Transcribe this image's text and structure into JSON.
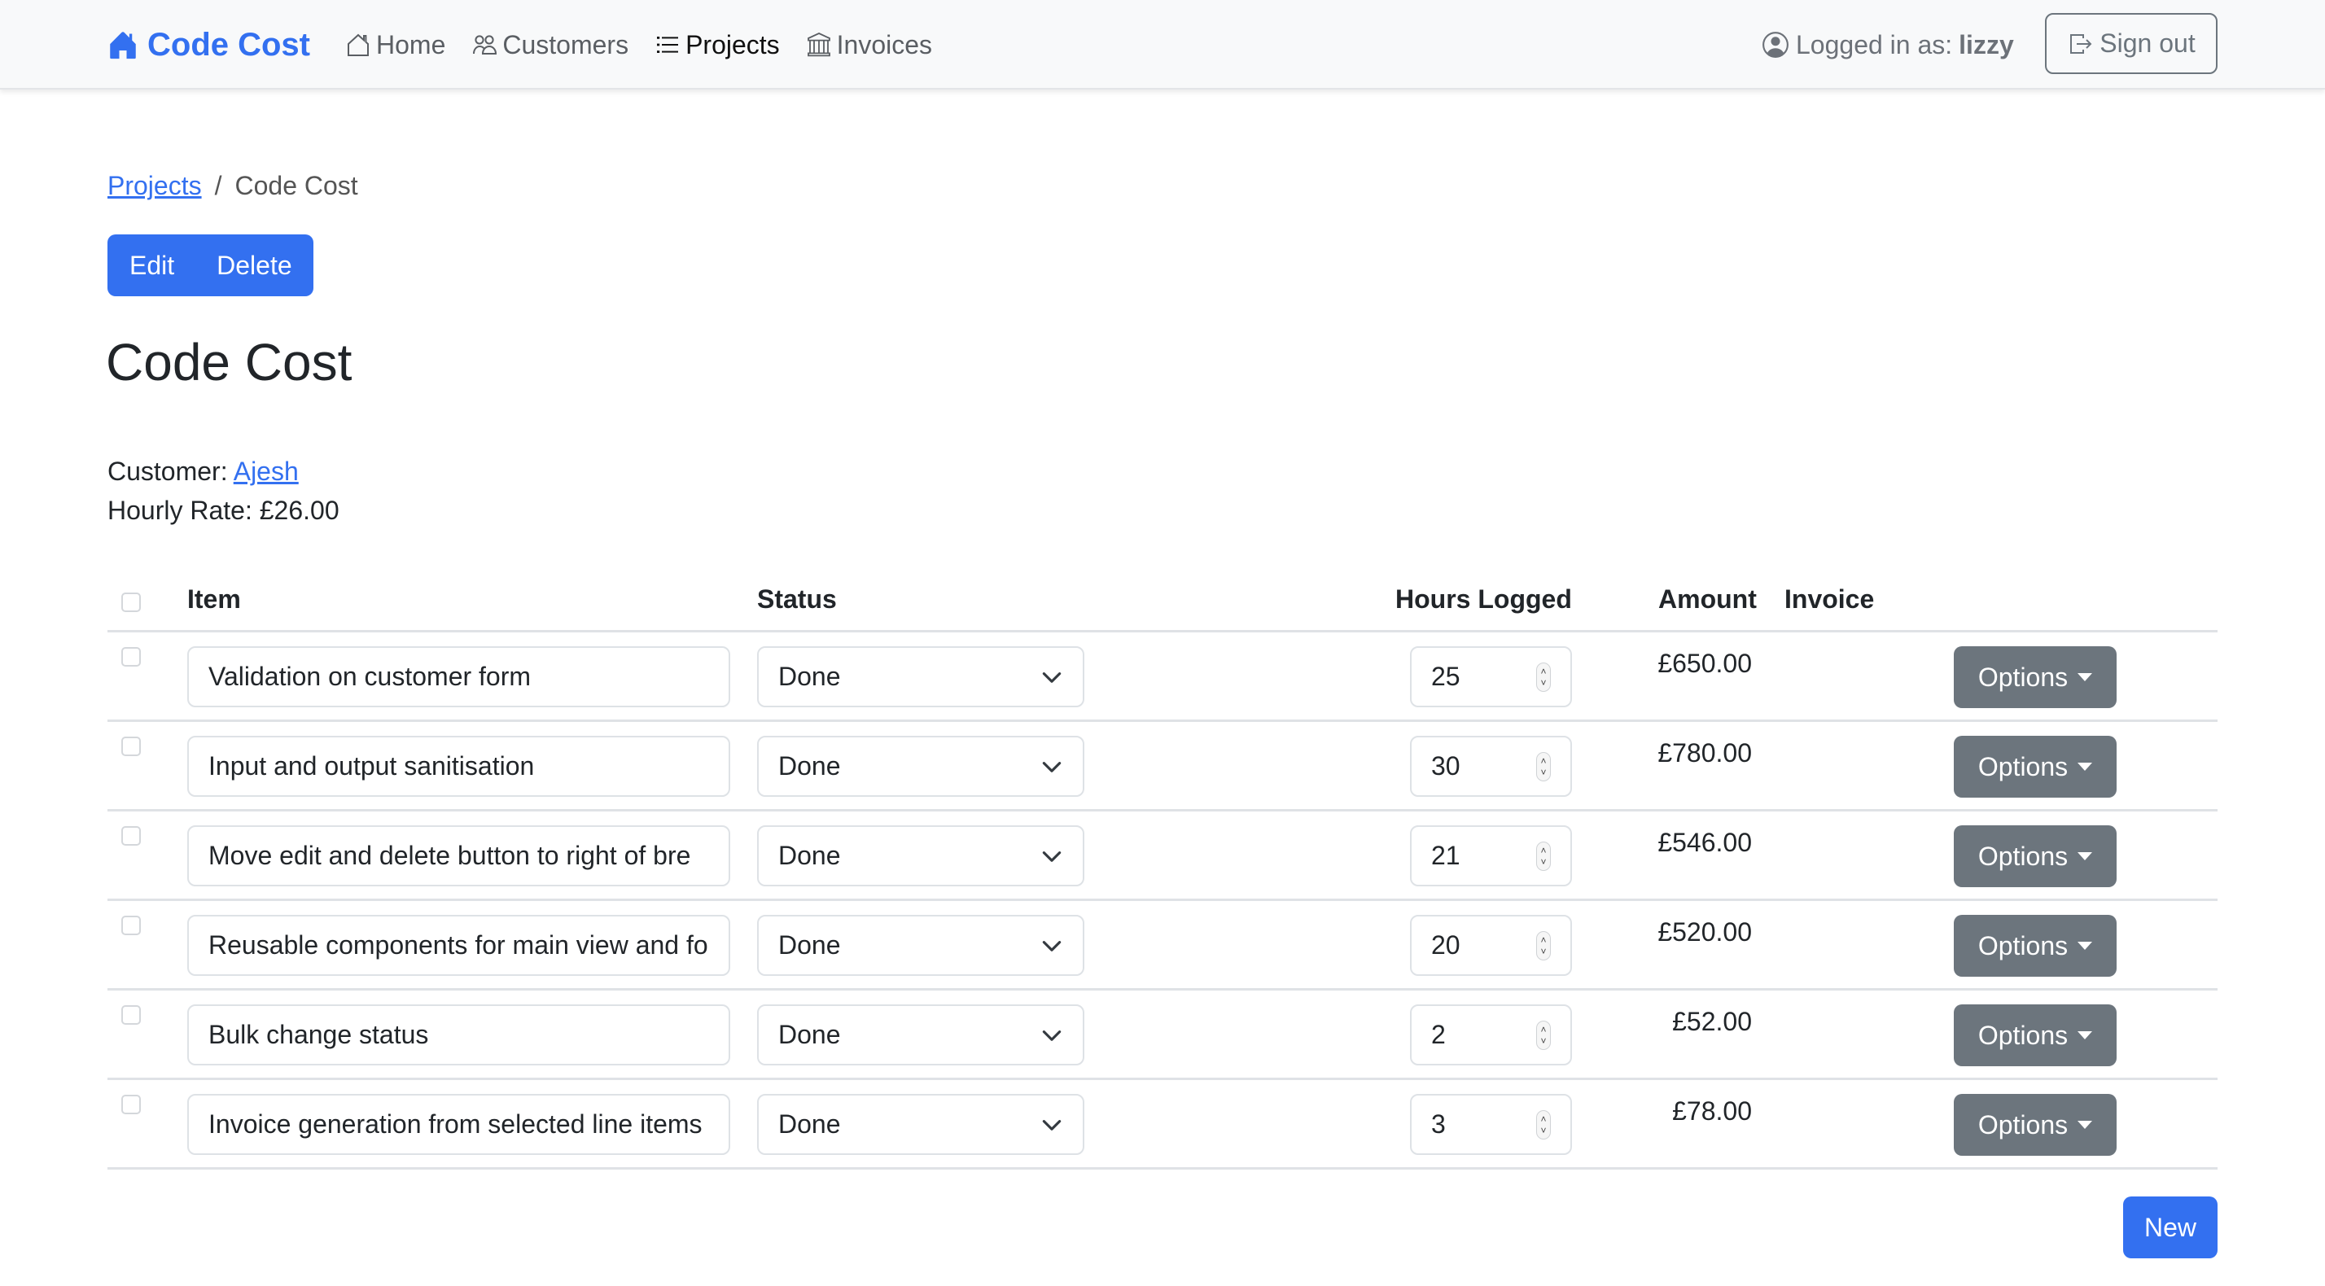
{
  "navbar": {
    "brand": "Code Cost",
    "items": [
      {
        "label": "Home",
        "icon": "house-icon",
        "active": false
      },
      {
        "label": "Customers",
        "icon": "people-icon",
        "active": false
      },
      {
        "label": "Projects",
        "icon": "list-icon",
        "active": true
      },
      {
        "label": "Invoices",
        "icon": "bank-icon",
        "active": false
      }
    ],
    "logged_in_prefix": "Logged in as:",
    "username": "lizzy",
    "sign_out_label": "Sign out"
  },
  "breadcrumb": {
    "parent": "Projects",
    "separator": "/",
    "current": "Code Cost"
  },
  "actions": {
    "edit_label": "Edit",
    "delete_label": "Delete"
  },
  "project": {
    "title": "Code Cost",
    "customer_label": "Customer:",
    "customer_name": "Ajesh",
    "rate_label": "Hourly Rate:",
    "rate_value": "£26.00"
  },
  "table": {
    "headers": {
      "item": "Item",
      "status": "Status",
      "hours": "Hours Logged",
      "amount": "Amount",
      "invoice": "Invoice"
    },
    "rows": [
      {
        "item": "Validation on customer form",
        "status": "Done",
        "hours": "25",
        "amount": "£650.00",
        "invoice": "",
        "options_label": "Options"
      },
      {
        "item": "Input and output sanitisation",
        "status": "Done",
        "hours": "30",
        "amount": "£780.00",
        "invoice": "",
        "options_label": "Options"
      },
      {
        "item": "Move edit and delete button to right of bre",
        "status": "Done",
        "hours": "21",
        "amount": "£546.00",
        "invoice": "",
        "options_label": "Options"
      },
      {
        "item": "Reusable components for main view and fo",
        "status": "Done",
        "hours": "20",
        "amount": "£520.00",
        "invoice": "",
        "options_label": "Options"
      },
      {
        "item": "Bulk change status",
        "status": "Done",
        "hours": "2",
        "amount": "£52.00",
        "invoice": "",
        "options_label": "Options"
      },
      {
        "item": "Invoice generation from selected line items",
        "status": "Done",
        "hours": "3",
        "amount": "£78.00",
        "invoice": "",
        "options_label": "Options"
      }
    ]
  },
  "new_label": "New",
  "colors": {
    "primary": "#3370f0",
    "secondary": "#6c757d",
    "navbar_bg": "#f8f9fa",
    "border": "#dee2e6"
  }
}
